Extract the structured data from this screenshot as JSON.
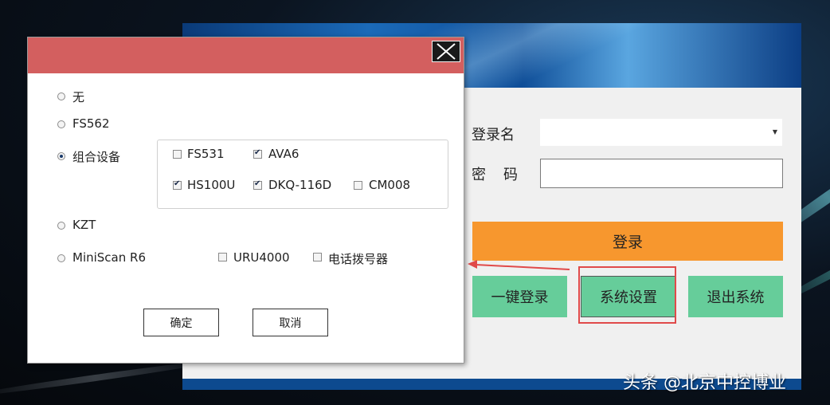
{
  "login": {
    "username_label": "登录名",
    "password_label": "密　码",
    "login_button": "登录",
    "quick_login_button": "一键登录",
    "settings_button": "系统设置",
    "exit_button": "退出系统"
  },
  "dialog": {
    "options": [
      {
        "label": "无",
        "selected": false
      },
      {
        "label": "FS562",
        "selected": false
      },
      {
        "label": "组合设备",
        "selected": true
      },
      {
        "label": "KZT",
        "selected": false
      },
      {
        "label": "MiniScan R6",
        "selected": false
      }
    ],
    "combo_devices": [
      {
        "label": "FS531",
        "checked": false
      },
      {
        "label": "AVA6",
        "checked": true
      },
      {
        "label": "HS100U",
        "checked": true
      },
      {
        "label": "DKQ-116D",
        "checked": true
      },
      {
        "label": "CM008",
        "checked": false
      }
    ],
    "extra_devices": [
      {
        "label": "URU4000",
        "checked": false
      },
      {
        "label": "电话拨号器",
        "checked": false
      }
    ],
    "confirm_button": "确定",
    "cancel_button": "取消"
  },
  "watermark": "头条 @北京中控博业",
  "colors": {
    "dialog_title": "#d35f5f",
    "login_button": "#f7972e",
    "secondary_buttons": "#66cd9a",
    "annotation": "#e04a4a"
  }
}
